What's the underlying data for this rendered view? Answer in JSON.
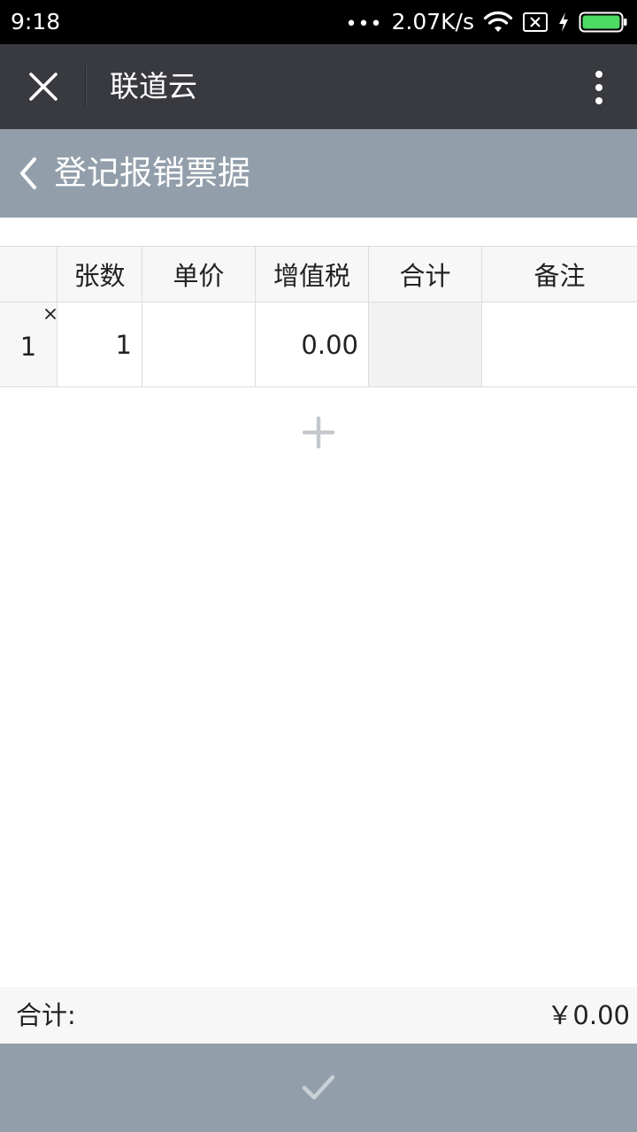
{
  "status_bar": {
    "time": "9:18",
    "dots": "•••",
    "network_speed": "2.07K/s",
    "icons": [
      "wifi-icon",
      "sim-blocked-icon",
      "charging-icon",
      "battery-icon"
    ],
    "battery_color": "#4cd964"
  },
  "topbar": {
    "title": "联道云",
    "close_icon": "close-icon",
    "more_icon": "more-vertical-icon",
    "background": "#393a3f"
  },
  "page_header": {
    "title": "登记报销票据",
    "back_icon": "chevron-left-icon",
    "background": "#929fab"
  },
  "table": {
    "columns": [
      "",
      "张数",
      "单价",
      "增值税",
      "合计",
      "备注"
    ],
    "rows": [
      {
        "index": "1",
        "count": "1",
        "unit_price": "",
        "vat": "0.00",
        "total": "",
        "note": ""
      }
    ],
    "delete_icon": "delete-row-icon",
    "add_icon": "plus-icon"
  },
  "summary": {
    "label": "合计:",
    "amount": "￥0.00"
  },
  "confirm": {
    "icon": "checkmark-icon"
  }
}
